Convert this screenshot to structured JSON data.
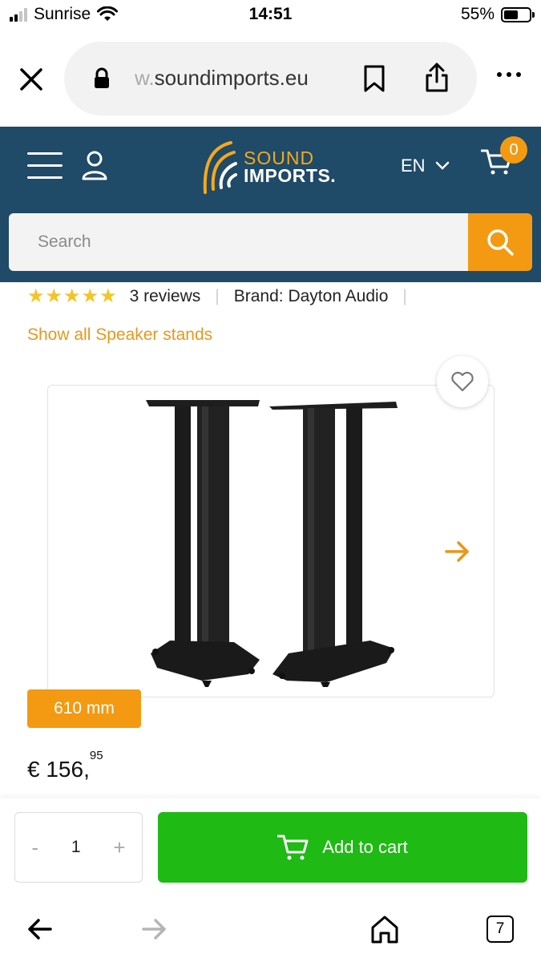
{
  "status_bar": {
    "carrier": "Sunrise",
    "time": "14:51",
    "battery": "55%",
    "battery_level": 0.55
  },
  "browser": {
    "url_faded": "w.",
    "url_main": "soundimports.eu",
    "icons": [
      "close-icon",
      "lock-icon",
      "bookmark-icon",
      "share-icon",
      "more-icon"
    ]
  },
  "site": {
    "logo_line1": "SOUND",
    "logo_line2": "IMPORTS.",
    "language": "EN",
    "cart_count": "0",
    "search_placeholder": "Search",
    "colors": {
      "header": "#1f4a68",
      "accent": "#f39a12",
      "cta": "#1fba14"
    }
  },
  "product": {
    "rating_stars": 5,
    "reviews": "3 reviews",
    "brand": "Brand: Dayton Audio",
    "category_link": "Show all Speaker stands",
    "size_badge": "610 mm",
    "price_main": "€ 156,",
    "price_cents": "95"
  },
  "purchase": {
    "qty_minus": "-",
    "qty_value": "1",
    "qty_plus": "+",
    "add_to_cart": "Add to cart"
  },
  "bottom_nav": {
    "tab_count": "7"
  }
}
